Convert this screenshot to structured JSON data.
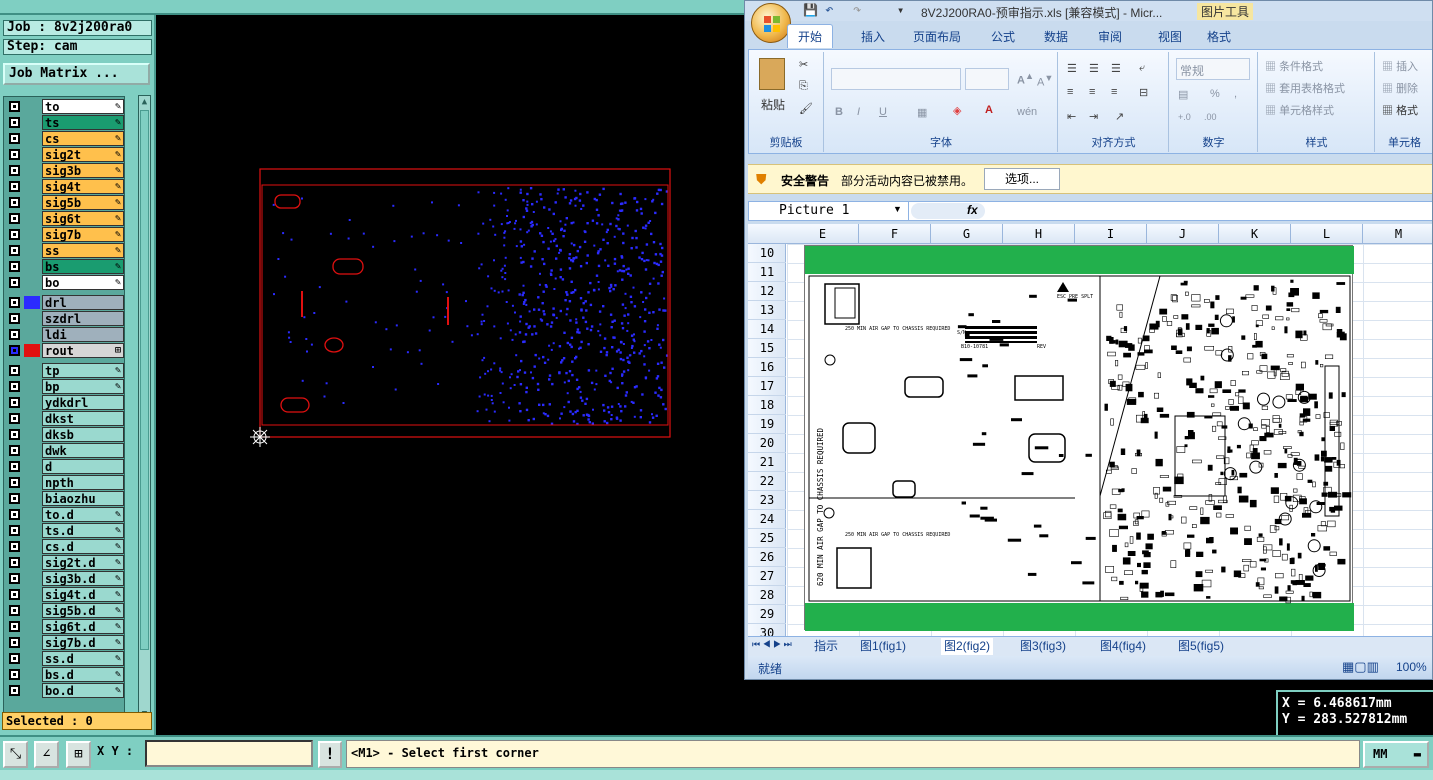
{
  "cam": {
    "job": "Job : 8v2j200ra0",
    "step": "Step: cam",
    "job_matrix_label": "Job Matrix ...",
    "layers_group1": [
      {
        "name": "to",
        "color": "#ffffff",
        "marker": "✎"
      },
      {
        "name": "ts",
        "color": "#1a9c70",
        "marker": "✎"
      },
      {
        "name": "cs",
        "color": "#ffc04c",
        "marker": "✎"
      },
      {
        "name": "sig2t",
        "color": "#ffc04c",
        "marker": "✎"
      },
      {
        "name": "sig3b",
        "color": "#ffc04c",
        "marker": "✎"
      },
      {
        "name": "sig4t",
        "color": "#ffc04c",
        "marker": "✎"
      },
      {
        "name": "sig5b",
        "color": "#ffc04c",
        "marker": "✎"
      },
      {
        "name": "sig6t",
        "color": "#ffc04c",
        "marker": "✎"
      },
      {
        "name": "sig7b",
        "color": "#ffc04c",
        "marker": "✎"
      },
      {
        "name": "ss",
        "color": "#ffc04c",
        "marker": "✎"
      },
      {
        "name": "bs",
        "color": "#1a9c70",
        "marker": "✎"
      },
      {
        "name": "bo",
        "color": "#ffffff",
        "marker": "✎"
      }
    ],
    "layers_group2": [
      {
        "name": "drl",
        "color": "#9fb0bc",
        "marker": ""
      },
      {
        "name": "szdrl",
        "color": "#9fb0bc",
        "marker": ""
      },
      {
        "name": "ldi",
        "color": "#9fb0bc",
        "marker": ""
      },
      {
        "name": "rout",
        "color": "#d6d6d6",
        "marker": "⊞"
      }
    ],
    "layers_group3": [
      {
        "name": "tp",
        "color": "#9ad9cf",
        "marker": "✎"
      },
      {
        "name": "bp",
        "color": "#9ad9cf",
        "marker": "✎"
      },
      {
        "name": "ydkdrl",
        "color": "#9ad9cf",
        "marker": ""
      },
      {
        "name": "dkst",
        "color": "#9ad9cf",
        "marker": ""
      },
      {
        "name": "dksb",
        "color": "#9ad9cf",
        "marker": ""
      },
      {
        "name": "dwk",
        "color": "#9ad9cf",
        "marker": ""
      },
      {
        "name": "d",
        "color": "#9ad9cf",
        "marker": ""
      },
      {
        "name": "npth",
        "color": "#9ad9cf",
        "marker": ""
      },
      {
        "name": "biaozhu",
        "color": "#9ad9cf",
        "marker": ""
      },
      {
        "name": "to.d",
        "color": "#9ad9cf",
        "marker": "✎"
      },
      {
        "name": "ts.d",
        "color": "#9ad9cf",
        "marker": "✎"
      },
      {
        "name": "cs.d",
        "color": "#9ad9cf",
        "marker": "✎"
      },
      {
        "name": "sig2t.d",
        "color": "#9ad9cf",
        "marker": "✎"
      },
      {
        "name": "sig3b.d",
        "color": "#9ad9cf",
        "marker": "✎"
      },
      {
        "name": "sig4t.d",
        "color": "#9ad9cf",
        "marker": "✎"
      },
      {
        "name": "sig5b.d",
        "color": "#9ad9cf",
        "marker": "✎"
      },
      {
        "name": "sig6t.d",
        "color": "#9ad9cf",
        "marker": "✎"
      },
      {
        "name": "sig7b.d",
        "color": "#9ad9cf",
        "marker": "✎"
      },
      {
        "name": "ss.d",
        "color": "#9ad9cf",
        "marker": "✎"
      },
      {
        "name": "bs.d",
        "color": "#9ad9cf",
        "marker": "✎"
      },
      {
        "name": "bo.d",
        "color": "#9ad9cf",
        "marker": "✎"
      }
    ],
    "selected": "Selected : 0",
    "xy_label": "X Y :",
    "xy_value": "",
    "bang_label": "!",
    "message": "<M1> - Select first corner",
    "unit": "MM",
    "coord_x": "X = 6.468617mm",
    "coord_y": "Y = 283.527812mm",
    "colors": {
      "outline": "#e01010",
      "pads": "#2b2bff",
      "panel": "#7fcfc2"
    }
  },
  "excel": {
    "title": "8V2J200RA0-预审指示.xls  [兼容模式] - Micr...",
    "context_tab": "图片工具",
    "tabs": [
      "开始",
      "插入",
      "页面布局",
      "公式",
      "数据",
      "审阅",
      "视图",
      "格式"
    ],
    "active_tab": "开始",
    "groups": {
      "clipboard": "剪贴板",
      "font": "字体",
      "align": "对齐方式",
      "number": "数字",
      "style": "样式",
      "cells": "单元格"
    },
    "paste_label": "粘贴",
    "number_format": "常规",
    "style_items": [
      "条件格式",
      "套用表格格式",
      "单元格样式"
    ],
    "cell_items": [
      "插入",
      "删除",
      "格式"
    ],
    "security_title": "安全警告",
    "security_text": "部分活动内容已被禁用。",
    "options_button": "选项...",
    "name_box": "Picture 1",
    "fx": "fx",
    "columns": [
      "E",
      "F",
      "G",
      "H",
      "I",
      "J",
      "K",
      "L",
      "M"
    ],
    "rows": [
      "10",
      "11",
      "12",
      "13",
      "14",
      "15",
      "16",
      "17",
      "18",
      "19",
      "20",
      "21",
      "22",
      "23",
      "24",
      "25",
      "26",
      "27",
      "28",
      "29",
      "30"
    ],
    "sheet_tabs": [
      "指示",
      "图1(fig1)",
      "图2(fig2)",
      "图3(fig3)",
      "图4(fig4)",
      "图5(fig5)"
    ],
    "active_sheet": "图2(fig2)",
    "status": "就绪",
    "zoom": "100%",
    "pcb_text": {
      "vertical": "620 MIN AIR GAP TO CHASSIS REQUIRED",
      "gap1": "250 MIN AIR GAP TO CHASSIS REQUIRED",
      "gap2": "250 MIN AIR GAP TO CHASSIS REQUIRED",
      "esc": "ESC PRE SPLT",
      "sn": "S/N",
      "code": "B10-10781",
      "rev": "REV"
    }
  }
}
